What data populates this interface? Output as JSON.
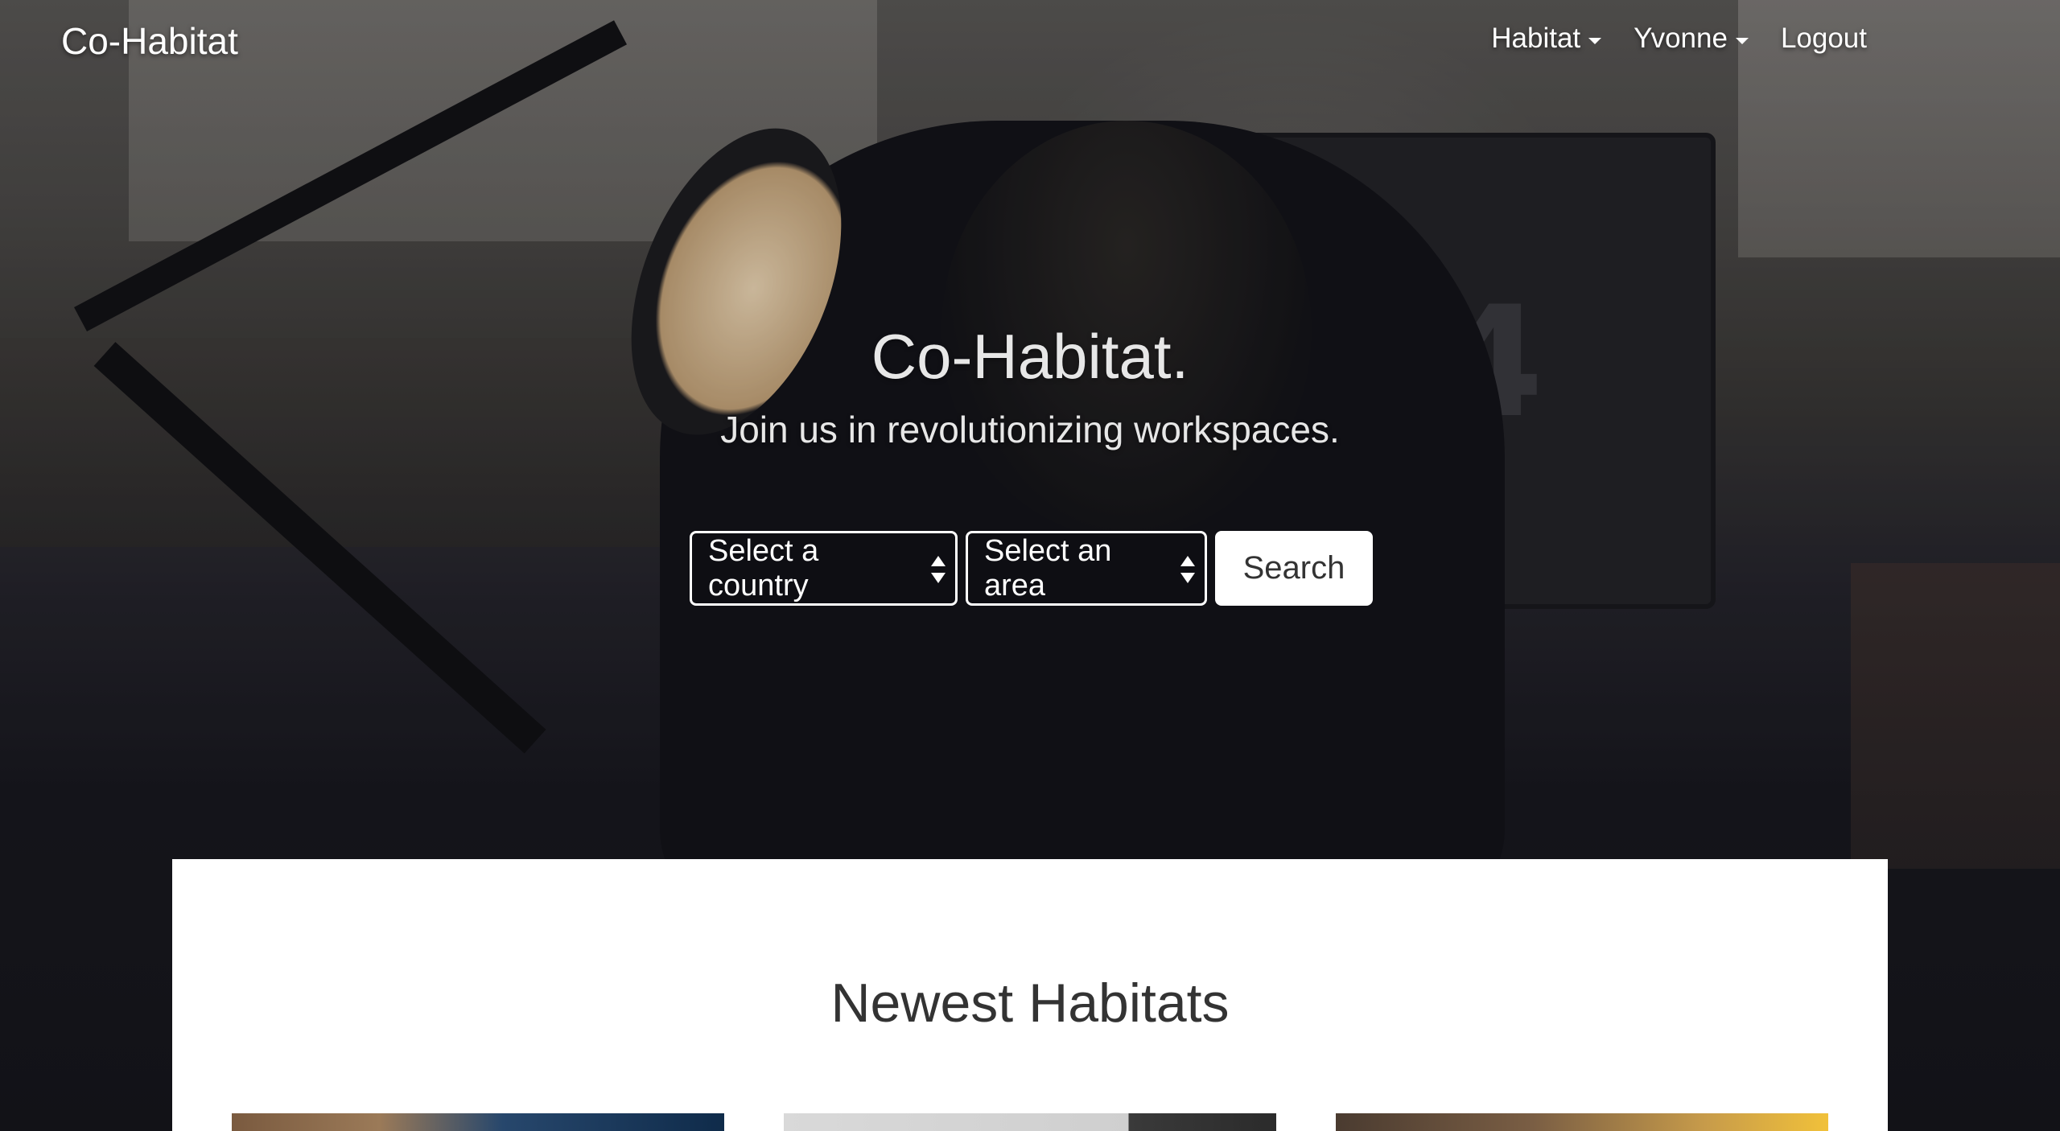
{
  "navbar": {
    "brand": "Co-Habitat",
    "items": [
      {
        "label": "Habitat",
        "has_dropdown": true
      },
      {
        "label": "Yvonne",
        "has_dropdown": true
      },
      {
        "label": "Logout",
        "has_dropdown": false
      }
    ]
  },
  "hero": {
    "title": "Co-Habitat.",
    "subtitle": "Join us in revolutionizing workspaces.",
    "background_decoration": "54"
  },
  "search": {
    "country_select": "Select a country",
    "area_select": "Select an area",
    "button_label": "Search"
  },
  "newest": {
    "title": "Newest Habitats",
    "cards": [
      {
        "image": "habitat-photo-1"
      },
      {
        "image": "habitat-photo-2"
      },
      {
        "image": "habitat-photo-3"
      }
    ]
  },
  "colors": {
    "text_light": "#ffffff",
    "panel_bg": "#ffffff",
    "panel_text": "#333333"
  }
}
